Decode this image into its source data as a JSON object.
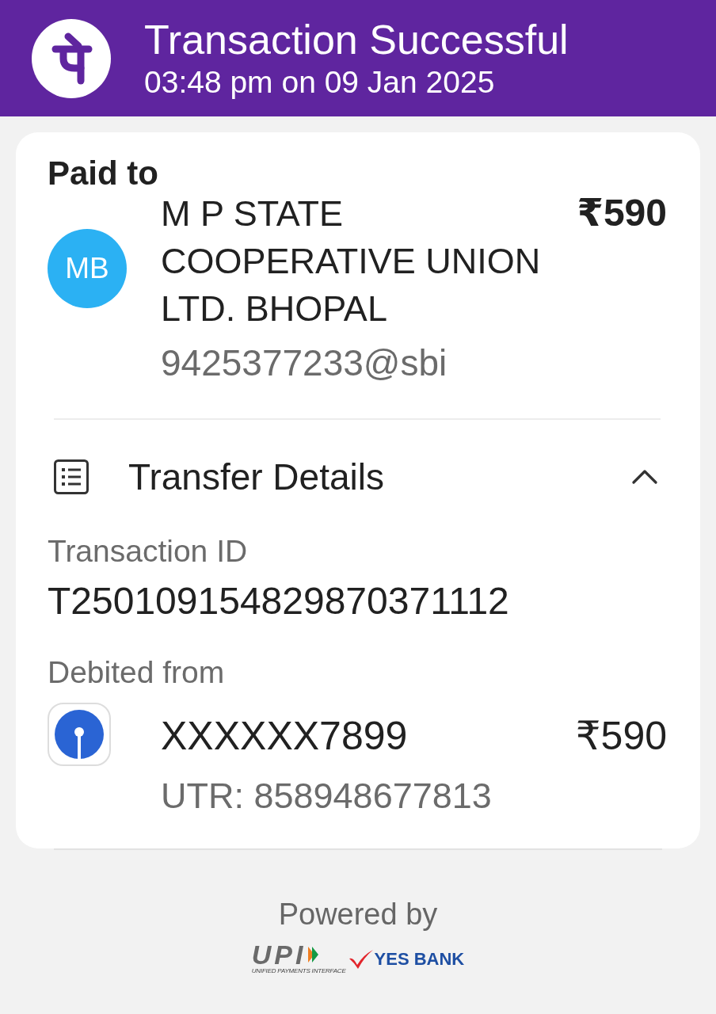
{
  "header": {
    "title": "Transaction Successful",
    "subtitle": "03:48 pm on 09 Jan 2025"
  },
  "paid_to": {
    "label": "Paid to",
    "initials": "MB",
    "name": "M P STATE COOPERATIVE UNION LTD. BHOPAL",
    "amount": "₹590",
    "upi_id": "9425377233@sbi"
  },
  "transfer_details": {
    "title": "Transfer Details",
    "expanded": true,
    "transaction_id": {
      "label": "Transaction ID",
      "value": "T250109154829870371112"
    },
    "debited_from": {
      "label": "Debited from",
      "account": "XXXXXX7899",
      "amount": "₹590",
      "utr": "UTR: 858948677813"
    }
  },
  "footer": {
    "powered_by": "Powered by",
    "upi_logo": "UPI",
    "upi_tagline": "UNIFIED PAYMENTS INTERFACE",
    "bank": "YES BANK"
  }
}
